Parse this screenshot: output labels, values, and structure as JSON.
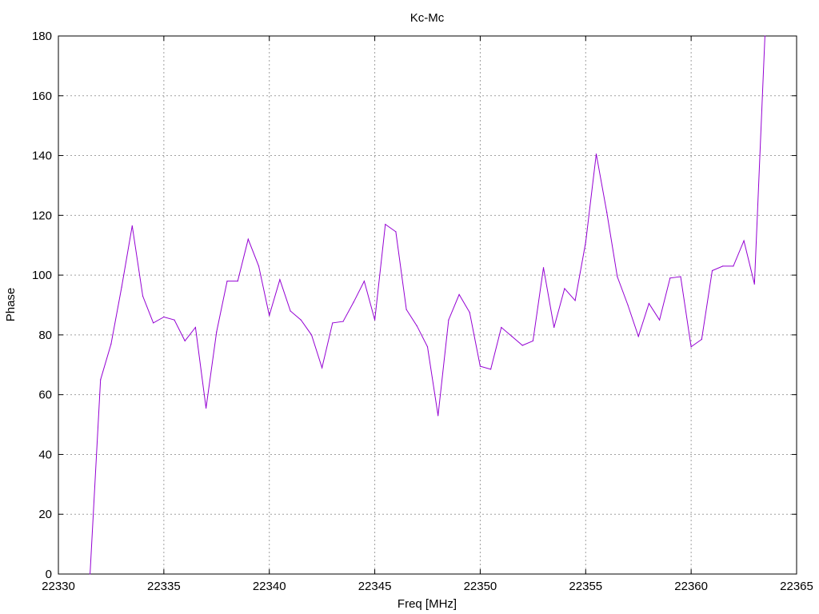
{
  "chart_data": {
    "type": "line",
    "title": "Kc-Mc",
    "xlabel": "Freq [MHz]",
    "ylabel": "Phase",
    "xlim": [
      22330,
      22365
    ],
    "ylim": [
      0,
      180
    ],
    "xticks": [
      22330,
      22335,
      22340,
      22345,
      22350,
      22355,
      22360,
      22365
    ],
    "yticks": [
      0,
      20,
      40,
      60,
      80,
      100,
      120,
      140,
      160,
      180
    ],
    "grid": true,
    "line_color": "#9400d3",
    "series": [
      {
        "x": [
          22331.5,
          22332.0,
          22332.5,
          22333.0,
          22333.5,
          22334.0,
          22334.5,
          22335.0,
          22335.5,
          22336.0,
          22336.5,
          22337.0,
          22337.5,
          22338.0,
          22338.5,
          22339.0,
          22339.5,
          22340.0,
          22340.5,
          22341.0,
          22341.5,
          22342.0,
          22342.5,
          22343.0,
          22343.5,
          22344.0,
          22344.5,
          22345.0,
          22345.5,
          22346.0,
          22346.5,
          22347.0,
          22347.5,
          22348.0,
          22348.5,
          22349.0,
          22349.5,
          22350.0,
          22350.5,
          22351.0,
          22351.5,
          22352.0,
          22352.5,
          22353.0,
          22353.5,
          22354.0,
          22354.5,
          22355.0,
          22355.5,
          22356.0,
          22356.5,
          22357.0,
          22357.5,
          22358.0,
          22358.5,
          22359.0,
          22359.5,
          22360.0,
          22360.5,
          22361.0,
          22361.5,
          22362.0,
          22362.5,
          22363.0,
          22363.5
        ],
        "y": [
          0,
          65,
          77,
          96,
          116.5,
          93,
          84,
          86,
          85,
          78,
          82.5,
          55.5,
          81,
          98,
          98,
          112,
          103,
          86.5,
          98.5,
          88,
          85,
          80,
          69,
          84,
          84.5,
          91,
          98,
          85,
          117,
          114.5,
          88.5,
          83,
          76,
          53,
          85,
          93.5,
          87.5,
          69.5,
          68.5,
          82.5,
          79.5,
          76.5,
          78,
          102.5,
          82.5,
          95.5,
          91.5,
          111,
          140.5,
          121,
          99.5,
          90,
          79.5,
          90.5,
          85,
          99,
          99.5,
          76,
          78.5,
          101.5,
          103,
          103,
          111.5,
          97,
          180
        ]
      }
    ]
  }
}
